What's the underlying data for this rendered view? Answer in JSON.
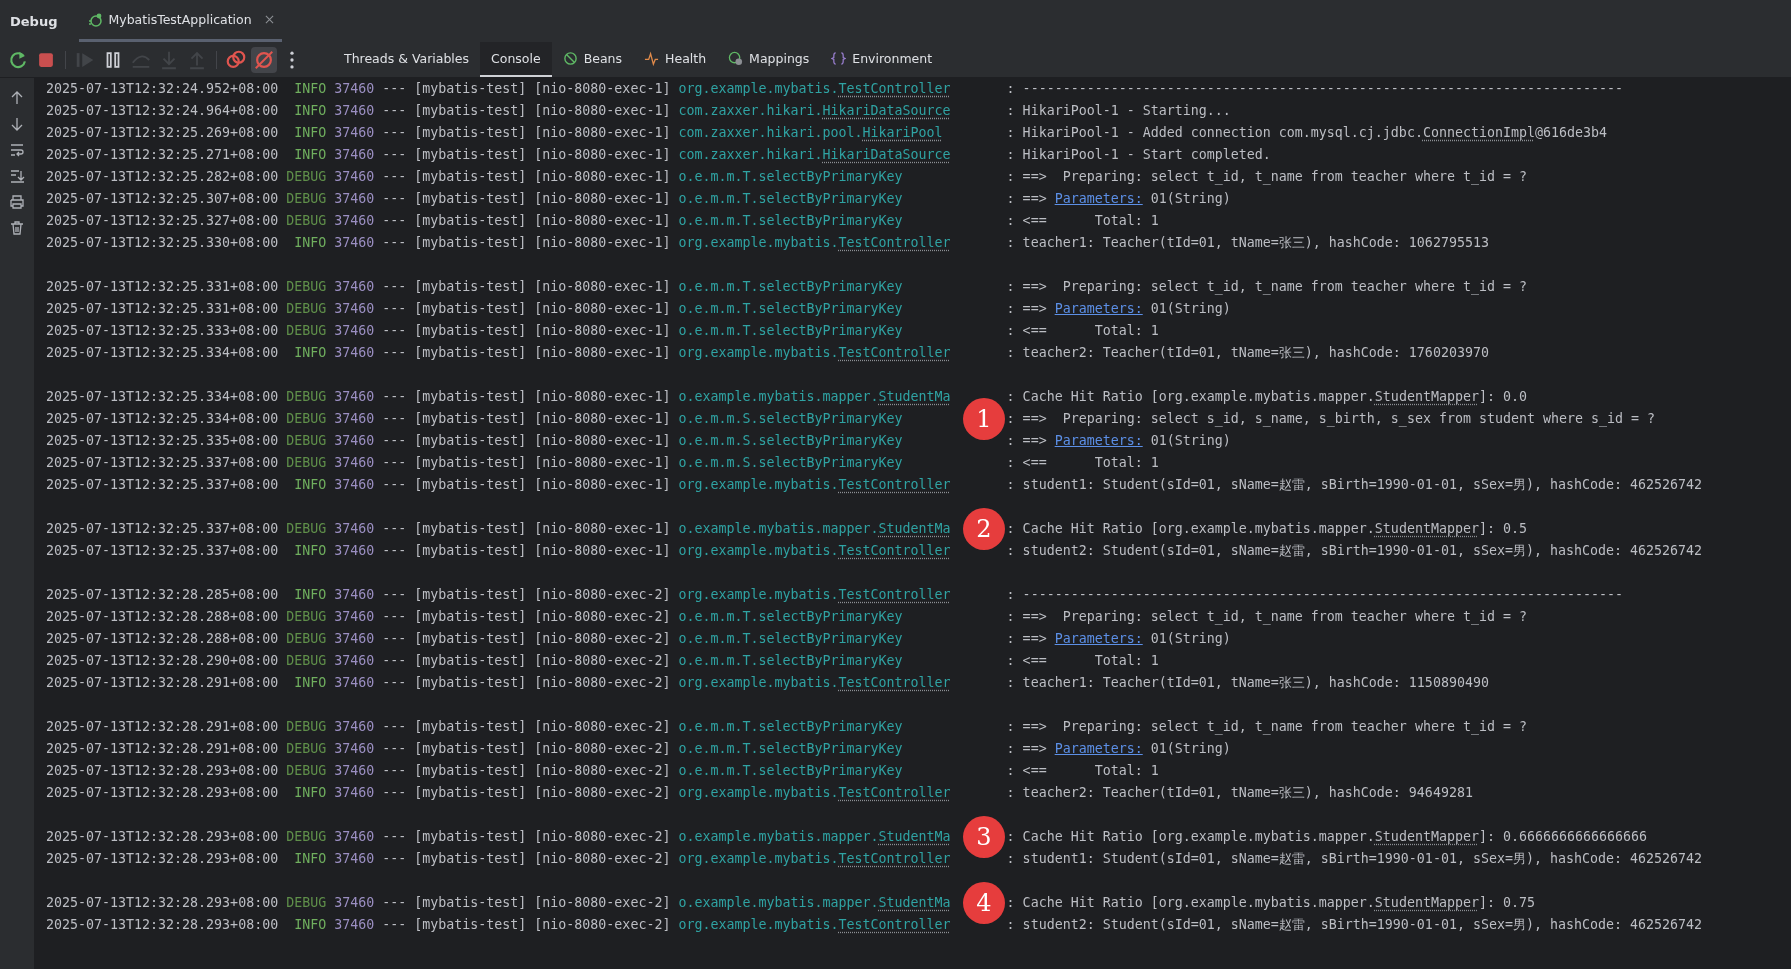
{
  "panel": {
    "title": "Debug",
    "session_tab": {
      "label": "MybatisTestApplication",
      "selected": true
    }
  },
  "debug_actions": [
    {
      "kind": "rerun",
      "disabled": false,
      "on": false
    },
    {
      "kind": "stop",
      "disabled": false,
      "on": false
    },
    {
      "kind": "resume",
      "disabled": true,
      "on": false
    },
    {
      "kind": "pause",
      "disabled": false,
      "on": false
    },
    {
      "kind": "step_over",
      "disabled": true,
      "on": false
    },
    {
      "kind": "step_into",
      "disabled": true,
      "on": false
    },
    {
      "kind": "step_out",
      "disabled": true,
      "on": false
    },
    {
      "kind": "breakpoints",
      "disabled": false,
      "on": false
    },
    {
      "kind": "mute",
      "disabled": false,
      "on": true
    },
    {
      "kind": "more",
      "disabled": false,
      "on": false
    }
  ],
  "view_tabs": [
    {
      "label": "Threads & Variables",
      "kind": "plain",
      "selected": false
    },
    {
      "label": "Console",
      "kind": "plain",
      "selected": true
    },
    {
      "label": "Beans",
      "kind": "beans",
      "selected": false
    },
    {
      "label": "Health",
      "kind": "health",
      "selected": false
    },
    {
      "label": "Mappings",
      "kind": "mappings",
      "selected": false
    },
    {
      "label": "Environment",
      "kind": "environment",
      "selected": false
    }
  ],
  "side_actions": [
    {
      "kind": "up"
    },
    {
      "kind": "down"
    },
    {
      "kind": "wrap"
    },
    {
      "kind": "scroll_end"
    },
    {
      "kind": "print"
    },
    {
      "kind": "trash"
    }
  ],
  "log_groups": [
    [
      {
        "time": "2025-07-13T12:32:24.952+08:00",
        "level": "INFO",
        "kind": "info",
        "pid": "37460",
        "sep": "---",
        "app": "[mybatis-test]",
        "thread": "[nio-8080-exec-1]",
        "logger": {
          "pkg": "org.example.mybatis.",
          "cls": "TestController"
        },
        "message": [
          {
            "t": ": ---------------------------------------------------------------------------",
            "kind": "plain"
          }
        ]
      },
      {
        "time": "2025-07-13T12:32:24.964+08:00",
        "level": "INFO",
        "kind": "info",
        "pid": "37460",
        "sep": "---",
        "app": "[mybatis-test]",
        "thread": "[nio-8080-exec-1]",
        "logger": {
          "pkg": "com.zaxxer.hikari.",
          "cls": "HikariDataSource"
        },
        "message": [
          {
            "t": ": HikariPool-1 - Starting...",
            "kind": "plain"
          }
        ]
      },
      {
        "time": "2025-07-13T12:32:25.269+08:00",
        "level": "INFO",
        "kind": "info",
        "pid": "37460",
        "sep": "---",
        "app": "[mybatis-test]",
        "thread": "[nio-8080-exec-1]",
        "logger": {
          "pkg": "com.zaxxer.hikari.pool.",
          "cls": "HikariPool"
        },
        "message": [
          {
            "t": ": HikariPool-1 - Added connection com.mysql.cj.jdbc.",
            "kind": "plain"
          },
          {
            "t": "ConnectionImpl",
            "kind": "ref"
          },
          {
            "t": "@616de3b4",
            "kind": "plain"
          }
        ]
      },
      {
        "time": "2025-07-13T12:32:25.271+08:00",
        "level": "INFO",
        "kind": "info",
        "pid": "37460",
        "sep": "---",
        "app": "[mybatis-test]",
        "thread": "[nio-8080-exec-1]",
        "logger": {
          "pkg": "com.zaxxer.hikari.",
          "cls": "HikariDataSource"
        },
        "message": [
          {
            "t": ": HikariPool-1 - Start completed.",
            "kind": "plain"
          }
        ]
      },
      {
        "time": "2025-07-13T12:32:25.282+08:00",
        "level": "DEBUG",
        "kind": "debug",
        "pid": "37460",
        "sep": "---",
        "app": "[mybatis-test]",
        "thread": "[nio-8080-exec-1]",
        "logger": {
          "pkg": "o.e.m.m.T.selectByPrimaryKey"
        },
        "message": [
          {
            "t": ": ==>  Preparing: select t_id, t_name from teacher where t_id = ?",
            "kind": "plain"
          }
        ]
      },
      {
        "time": "2025-07-13T12:32:25.307+08:00",
        "level": "DEBUG",
        "kind": "debug",
        "pid": "37460",
        "sep": "---",
        "app": "[mybatis-test]",
        "thread": "[nio-8080-exec-1]",
        "logger": {
          "pkg": "o.e.m.m.T.selectByPrimaryKey"
        },
        "message": [
          {
            "t": ": ==> ",
            "kind": "plain"
          },
          {
            "t": "Parameters:",
            "kind": "link"
          },
          {
            "t": " 01(String)",
            "kind": "plain"
          }
        ]
      },
      {
        "time": "2025-07-13T12:32:25.327+08:00",
        "level": "DEBUG",
        "kind": "debug",
        "pid": "37460",
        "sep": "---",
        "app": "[mybatis-test]",
        "thread": "[nio-8080-exec-1]",
        "logger": {
          "pkg": "o.e.m.m.T.selectByPrimaryKey"
        },
        "message": [
          {
            "t": ": <==      Total: 1",
            "kind": "plain"
          }
        ]
      },
      {
        "time": "2025-07-13T12:32:25.330+08:00",
        "level": "INFO",
        "kind": "info",
        "pid": "37460",
        "sep": "---",
        "app": "[mybatis-test]",
        "thread": "[nio-8080-exec-1]",
        "logger": {
          "pkg": "org.example.mybatis.",
          "cls": "TestController"
        },
        "message": [
          {
            "t": ": teacher1: Teacher(tId=01, tName=张三), hashCode: 1062795513",
            "kind": "plain"
          }
        ]
      }
    ],
    [
      {
        "time": "2025-07-13T12:32:25.331+08:00",
        "level": "DEBUG",
        "kind": "debug",
        "pid": "37460",
        "sep": "---",
        "app": "[mybatis-test]",
        "thread": "[nio-8080-exec-1]",
        "logger": {
          "pkg": "o.e.m.m.T.selectByPrimaryKey"
        },
        "message": [
          {
            "t": ": ==>  Preparing: select t_id, t_name from teacher where t_id = ?",
            "kind": "plain"
          }
        ]
      },
      {
        "time": "2025-07-13T12:32:25.331+08:00",
        "level": "DEBUG",
        "kind": "debug",
        "pid": "37460",
        "sep": "---",
        "app": "[mybatis-test]",
        "thread": "[nio-8080-exec-1]",
        "logger": {
          "pkg": "o.e.m.m.T.selectByPrimaryKey"
        },
        "message": [
          {
            "t": ": ==> ",
            "kind": "plain"
          },
          {
            "t": "Parameters:",
            "kind": "link"
          },
          {
            "t": " 01(String)",
            "kind": "plain"
          }
        ]
      },
      {
        "time": "2025-07-13T12:32:25.333+08:00",
        "level": "DEBUG",
        "kind": "debug",
        "pid": "37460",
        "sep": "---",
        "app": "[mybatis-test]",
        "thread": "[nio-8080-exec-1]",
        "logger": {
          "pkg": "o.e.m.m.T.selectByPrimaryKey"
        },
        "message": [
          {
            "t": ": <==      Total: 1",
            "kind": "plain"
          }
        ]
      },
      {
        "time": "2025-07-13T12:32:25.334+08:00",
        "level": "INFO",
        "kind": "info",
        "pid": "37460",
        "sep": "---",
        "app": "[mybatis-test]",
        "thread": "[nio-8080-exec-1]",
        "logger": {
          "pkg": "org.example.mybatis.",
          "cls": "TestController"
        },
        "message": [
          {
            "t": ": teacher2: Teacher(tId=01, tName=张三), hashCode: 1760203970",
            "kind": "plain"
          }
        ]
      }
    ],
    [
      {
        "time": "2025-07-13T12:32:25.334+08:00",
        "level": "DEBUG",
        "kind": "debug",
        "pid": "37460",
        "sep": "---",
        "app": "[mybatis-test]",
        "thread": "[nio-8080-exec-1]",
        "logger": {
          "pkg": "o.example.mybatis.mapper.",
          "cls": "StudentMa"
        },
        "message": [
          {
            "t": ": Cache Hit Ratio [org.example.mybatis.mapper.",
            "kind": "plain"
          },
          {
            "t": "StudentMapper",
            "kind": "ref"
          },
          {
            "t": "]: 0.0",
            "kind": "plain"
          }
        ]
      },
      {
        "time": "2025-07-13T12:32:25.334+08:00",
        "level": "DEBUG",
        "kind": "debug",
        "pid": "37460",
        "sep": "---",
        "app": "[mybatis-test]",
        "thread": "[nio-8080-exec-1]",
        "logger": {
          "pkg": "o.e.m.m.S.selectByPrimaryKey"
        },
        "marker": "1",
        "message": [
          {
            "t": ": ==>  Preparing: select s_id, s_name, s_birth, s_sex from student where s_id = ?",
            "kind": "plain"
          }
        ]
      },
      {
        "time": "2025-07-13T12:32:25.335+08:00",
        "level": "DEBUG",
        "kind": "debug",
        "pid": "37460",
        "sep": "---",
        "app": "[mybatis-test]",
        "thread": "[nio-8080-exec-1]",
        "logger": {
          "pkg": "o.e.m.m.S.selectByPrimaryKey"
        },
        "message": [
          {
            "t": ": ==> ",
            "kind": "plain"
          },
          {
            "t": "Parameters:",
            "kind": "link"
          },
          {
            "t": " 01(String)",
            "kind": "plain"
          }
        ]
      },
      {
        "time": "2025-07-13T12:32:25.337+08:00",
        "level": "DEBUG",
        "kind": "debug",
        "pid": "37460",
        "sep": "---",
        "app": "[mybatis-test]",
        "thread": "[nio-8080-exec-1]",
        "logger": {
          "pkg": "o.e.m.m.S.selectByPrimaryKey"
        },
        "message": [
          {
            "t": ": <==      Total: 1",
            "kind": "plain"
          }
        ]
      },
      {
        "time": "2025-07-13T12:32:25.337+08:00",
        "level": "INFO",
        "kind": "info",
        "pid": "37460",
        "sep": "---",
        "app": "[mybatis-test]",
        "thread": "[nio-8080-exec-1]",
        "logger": {
          "pkg": "org.example.mybatis.",
          "cls": "TestController"
        },
        "message": [
          {
            "t": ": student1: Student(sId=01, sName=赵雷, sBirth=1990-01-01, sSex=男), hashCode: 462526742",
            "kind": "plain"
          }
        ]
      }
    ],
    [
      {
        "time": "2025-07-13T12:32:25.337+08:00",
        "level": "DEBUG",
        "kind": "debug",
        "pid": "37460",
        "sep": "---",
        "app": "[mybatis-test]",
        "thread": "[nio-8080-exec-1]",
        "logger": {
          "pkg": "o.example.mybatis.mapper.",
          "cls": "StudentMa"
        },
        "marker": "2",
        "message": [
          {
            "t": ": Cache Hit Ratio [org.example.mybatis.mapper.",
            "kind": "plain"
          },
          {
            "t": "StudentMapper",
            "kind": "ref"
          },
          {
            "t": "]: 0.5",
            "kind": "plain"
          }
        ]
      },
      {
        "time": "2025-07-13T12:32:25.337+08:00",
        "level": "INFO",
        "kind": "info",
        "pid": "37460",
        "sep": "---",
        "app": "[mybatis-test]",
        "thread": "[nio-8080-exec-1]",
        "logger": {
          "pkg": "org.example.mybatis.",
          "cls": "TestController"
        },
        "message": [
          {
            "t": ": student2: Student(sId=01, sName=赵雷, sBirth=1990-01-01, sSex=男), hashCode: 462526742",
            "kind": "plain"
          }
        ]
      }
    ],
    [
      {
        "time": "2025-07-13T12:32:28.285+08:00",
        "level": "INFO",
        "kind": "info",
        "pid": "37460",
        "sep": "---",
        "app": "[mybatis-test]",
        "thread": "[nio-8080-exec-2]",
        "logger": {
          "pkg": "org.example.mybatis.",
          "cls": "TestController"
        },
        "message": [
          {
            "t": ": ---------------------------------------------------------------------------",
            "kind": "plain"
          }
        ]
      },
      {
        "time": "2025-07-13T12:32:28.288+08:00",
        "level": "DEBUG",
        "kind": "debug",
        "pid": "37460",
        "sep": "---",
        "app": "[mybatis-test]",
        "thread": "[nio-8080-exec-2]",
        "logger": {
          "pkg": "o.e.m.m.T.selectByPrimaryKey"
        },
        "message": [
          {
            "t": ": ==>  Preparing: select t_id, t_name from teacher where t_id = ?",
            "kind": "plain"
          }
        ]
      },
      {
        "time": "2025-07-13T12:32:28.288+08:00",
        "level": "DEBUG",
        "kind": "debug",
        "pid": "37460",
        "sep": "---",
        "app": "[mybatis-test]",
        "thread": "[nio-8080-exec-2]",
        "logger": {
          "pkg": "o.e.m.m.T.selectByPrimaryKey"
        },
        "message": [
          {
            "t": ": ==> ",
            "kind": "plain"
          },
          {
            "t": "Parameters:",
            "kind": "link"
          },
          {
            "t": " 01(String)",
            "kind": "plain"
          }
        ]
      },
      {
        "time": "2025-07-13T12:32:28.290+08:00",
        "level": "DEBUG",
        "kind": "debug",
        "pid": "37460",
        "sep": "---",
        "app": "[mybatis-test]",
        "thread": "[nio-8080-exec-2]",
        "logger": {
          "pkg": "o.e.m.m.T.selectByPrimaryKey"
        },
        "message": [
          {
            "t": ": <==      Total: 1",
            "kind": "plain"
          }
        ]
      },
      {
        "time": "2025-07-13T12:32:28.291+08:00",
        "level": "INFO",
        "kind": "info",
        "pid": "37460",
        "sep": "---",
        "app": "[mybatis-test]",
        "thread": "[nio-8080-exec-2]",
        "logger": {
          "pkg": "org.example.mybatis.",
          "cls": "TestController"
        },
        "message": [
          {
            "t": ": teacher1: Teacher(tId=01, tName=张三), hashCode: 1150890490",
            "kind": "plain"
          }
        ]
      }
    ],
    [
      {
        "time": "2025-07-13T12:32:28.291+08:00",
        "level": "DEBUG",
        "kind": "debug",
        "pid": "37460",
        "sep": "---",
        "app": "[mybatis-test]",
        "thread": "[nio-8080-exec-2]",
        "logger": {
          "pkg": "o.e.m.m.T.selectByPrimaryKey"
        },
        "message": [
          {
            "t": ": ==>  Preparing: select t_id, t_name from teacher where t_id = ?",
            "kind": "plain"
          }
        ]
      },
      {
        "time": "2025-07-13T12:32:28.291+08:00",
        "level": "DEBUG",
        "kind": "debug",
        "pid": "37460",
        "sep": "---",
        "app": "[mybatis-test]",
        "thread": "[nio-8080-exec-2]",
        "logger": {
          "pkg": "o.e.m.m.T.selectByPrimaryKey"
        },
        "message": [
          {
            "t": ": ==> ",
            "kind": "plain"
          },
          {
            "t": "Parameters:",
            "kind": "link"
          },
          {
            "t": " 01(String)",
            "kind": "plain"
          }
        ]
      },
      {
        "time": "2025-07-13T12:32:28.293+08:00",
        "level": "DEBUG",
        "kind": "debug",
        "pid": "37460",
        "sep": "---",
        "app": "[mybatis-test]",
        "thread": "[nio-8080-exec-2]",
        "logger": {
          "pkg": "o.e.m.m.T.selectByPrimaryKey"
        },
        "message": [
          {
            "t": ": <==      Total: 1",
            "kind": "plain"
          }
        ]
      },
      {
        "time": "2025-07-13T12:32:28.293+08:00",
        "level": "INFO",
        "kind": "info",
        "pid": "37460",
        "sep": "---",
        "app": "[mybatis-test]",
        "thread": "[nio-8080-exec-2]",
        "logger": {
          "pkg": "org.example.mybatis.",
          "cls": "TestController"
        },
        "message": [
          {
            "t": ": teacher2: Teacher(tId=01, tName=张三), hashCode: 94649281",
            "kind": "plain"
          }
        ]
      }
    ],
    [
      {
        "time": "2025-07-13T12:32:28.293+08:00",
        "level": "DEBUG",
        "kind": "debug",
        "pid": "37460",
        "sep": "---",
        "app": "[mybatis-test]",
        "thread": "[nio-8080-exec-2]",
        "logger": {
          "pkg": "o.example.mybatis.mapper.",
          "cls": "StudentMa"
        },
        "marker": "3",
        "message": [
          {
            "t": ": Cache Hit Ratio [org.example.mybatis.mapper.",
            "kind": "plain"
          },
          {
            "t": "StudentMapper",
            "kind": "ref"
          },
          {
            "t": "]: 0.6666666666666666",
            "kind": "plain"
          }
        ]
      },
      {
        "time": "2025-07-13T12:32:28.293+08:00",
        "level": "INFO",
        "kind": "info",
        "pid": "37460",
        "sep": "---",
        "app": "[mybatis-test]",
        "thread": "[nio-8080-exec-2]",
        "logger": {
          "pkg": "org.example.mybatis.",
          "cls": "TestController"
        },
        "message": [
          {
            "t": ": student1: Student(sId=01, sName=赵雷, sBirth=1990-01-01, sSex=男), hashCode: 462526742",
            "kind": "plain"
          }
        ]
      }
    ],
    [
      {
        "time": "2025-07-13T12:32:28.293+08:00",
        "level": "DEBUG",
        "kind": "debug",
        "pid": "37460",
        "sep": "---",
        "app": "[mybatis-test]",
        "thread": "[nio-8080-exec-2]",
        "logger": {
          "pkg": "o.example.mybatis.mapper.",
          "cls": "StudentMa"
        },
        "marker": "4",
        "message": [
          {
            "t": ": Cache Hit Ratio [org.example.mybatis.mapper.",
            "kind": "plain"
          },
          {
            "t": "StudentMapper",
            "kind": "ref"
          },
          {
            "t": "]: 0.75",
            "kind": "plain"
          }
        ]
      },
      {
        "time": "2025-07-13T12:32:28.293+08:00",
        "level": "INFO",
        "kind": "info",
        "pid": "37460",
        "sep": "---",
        "app": "[mybatis-test]",
        "thread": "[nio-8080-exec-2]",
        "logger": {
          "pkg": "org.example.mybatis.",
          "cls": "TestController"
        },
        "message": [
          {
            "t": ": student2: Student(sId=01, sName=赵雷, sBirth=1990-01-01, sSex=男), hashCode: 462526742",
            "kind": "plain"
          }
        ]
      }
    ]
  ]
}
